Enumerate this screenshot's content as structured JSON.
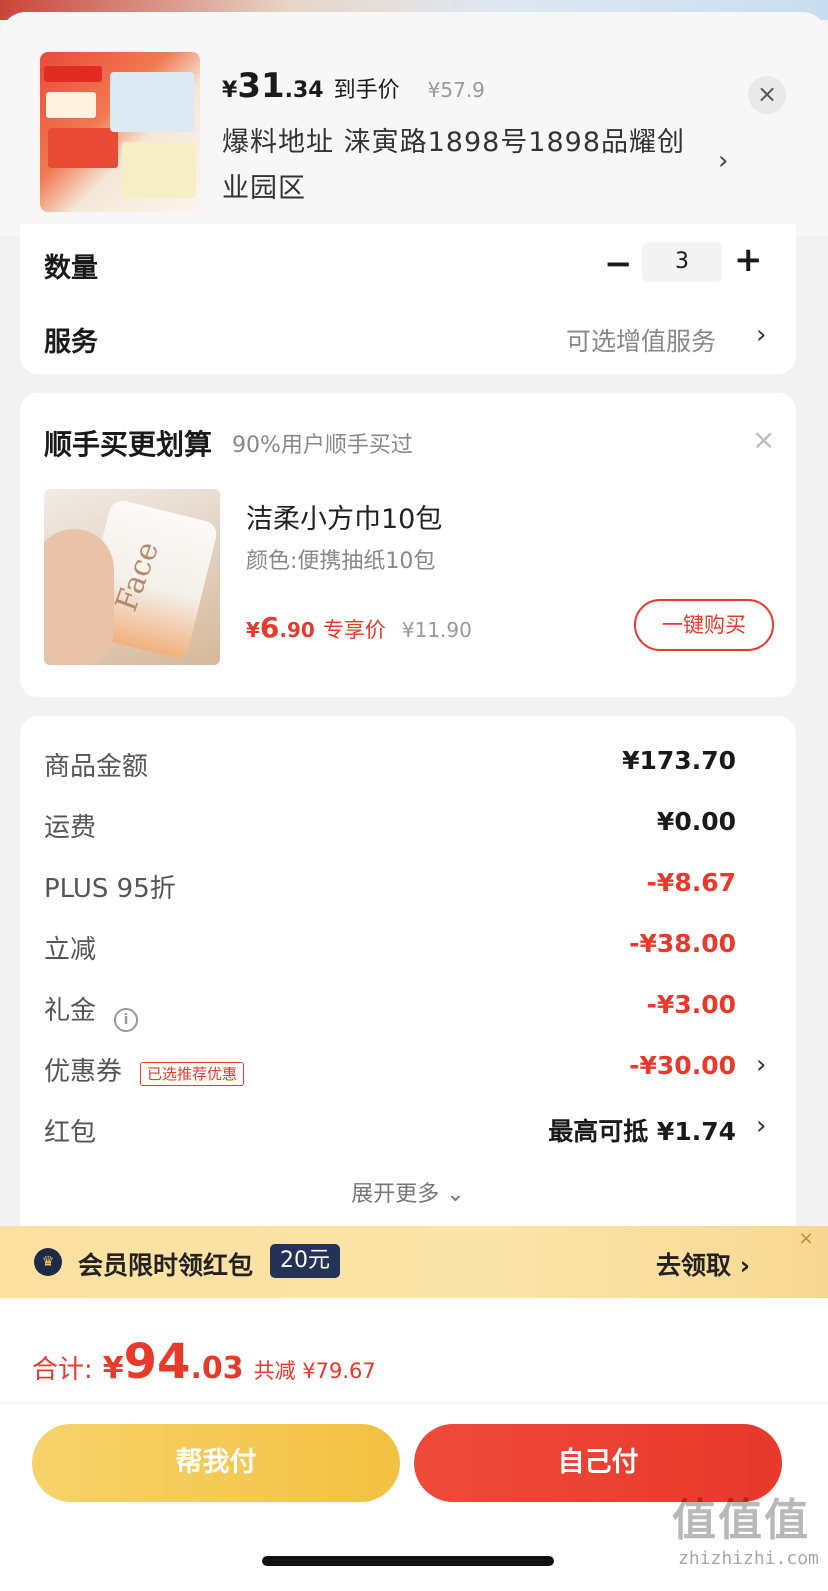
{
  "header": {
    "price_currency": "¥",
    "price_int": "31",
    "price_dec": ".34",
    "price_label": "到手价",
    "orig_price": "¥57.9",
    "address": "爆料地址  涞寅路1898号1898品耀创业园区",
    "close_icon": "close-icon"
  },
  "qty": {
    "label": "数量",
    "minus": "−",
    "value": "3",
    "plus": "+"
  },
  "service": {
    "label": "服务",
    "value": "可选增值服务",
    "chevron": "›"
  },
  "addon": {
    "title": "顺手买更划算",
    "subtitle": "90%用户顺手买过",
    "close": "×",
    "product_name": "洁柔小方巾10包",
    "spec": "颜色:便携抽纸10包",
    "price_currency": "¥",
    "price_int": "6",
    "price_dec": ".90",
    "price_tag": "专享价",
    "orig_price": "¥11.90",
    "buy_label": "一键购买",
    "image_logo": "Face"
  },
  "fees": {
    "goods_label": "商品金额",
    "goods_value": "¥173.70",
    "shipping_label": "运费",
    "shipping_value": "¥0.00",
    "plus_label": "PLUS 95折",
    "plus_value": "-¥8.67",
    "instant_label": "立减",
    "instant_value": "-¥38.00",
    "gift_label": "礼金",
    "gift_info_icon": "i",
    "gift_value": "-¥3.00",
    "coupon_label": "优惠券",
    "coupon_tag": "已选推荐优惠",
    "coupon_value": "-¥30.00",
    "redpacket_label": "红包",
    "redpacket_value": "最高可抵 ¥1.74",
    "chevron": "›",
    "expand_label": "展开更多 ⌄"
  },
  "banner": {
    "icon_glyph": "♛",
    "text": "会员限时领红包",
    "badge": "20元",
    "action": "去领取 ›",
    "close": "×"
  },
  "footer": {
    "total_label": "合计:",
    "total_currency": "¥",
    "total_int": "94",
    "total_dec": ".03",
    "total_saving": "共减 ¥79.67",
    "help_pay": "帮我付",
    "self_pay": "自己付"
  },
  "watermark": {
    "main": "值值值",
    "sub": "zhizhizhi.com"
  },
  "colors": {
    "accent_red": "#e8392b",
    "accent_yellow": "#f3c142",
    "badge_navy": "#253258"
  }
}
